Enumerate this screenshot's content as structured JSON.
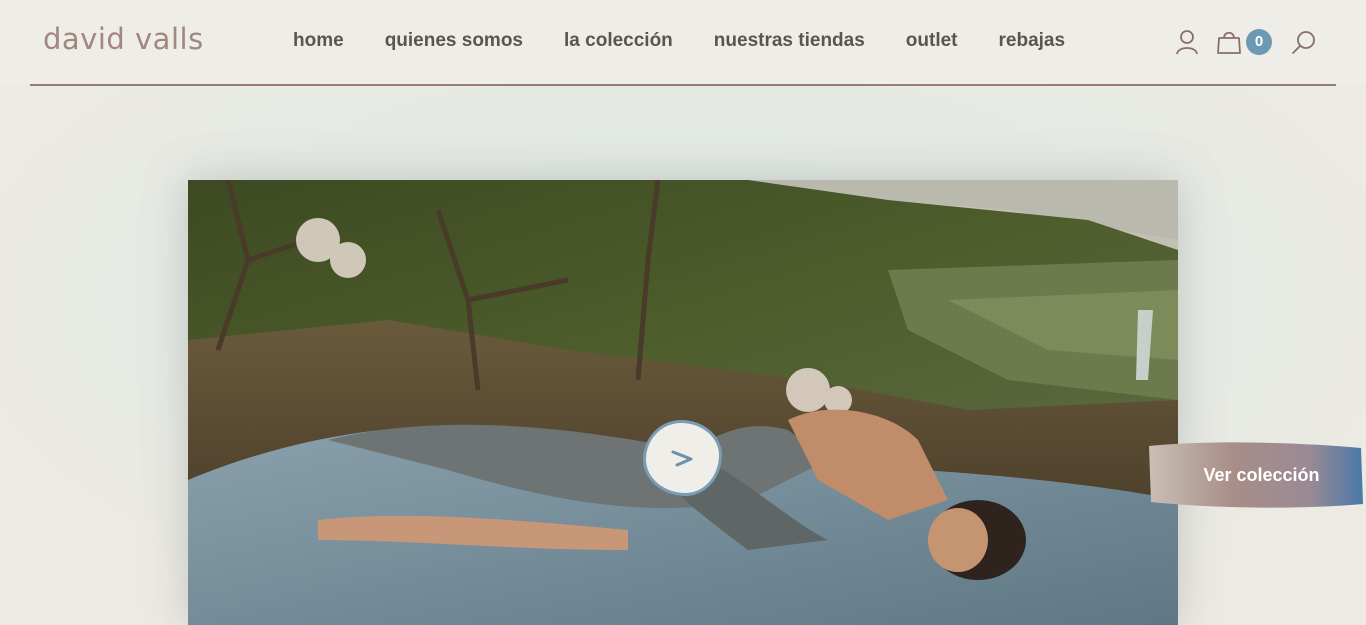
{
  "header": {
    "logo": "david valls",
    "nav": [
      "home",
      "quienes somos",
      "la colección",
      "nuestras tiendas",
      "outlet",
      "rebajas"
    ],
    "cart_count": "0",
    "icons": [
      "user-icon",
      "shopping-bag-icon",
      "search-icon"
    ]
  },
  "hero": {
    "image": "woman-lying-on-blanket-mountain-landscape",
    "play_icon": "chevron-right-icon",
    "cta_label": "Ver colección"
  },
  "colors": {
    "accent": "#9a7c76",
    "badge": "#6d99b3",
    "nav_text": "#5d5450",
    "background": "#eceae3"
  }
}
